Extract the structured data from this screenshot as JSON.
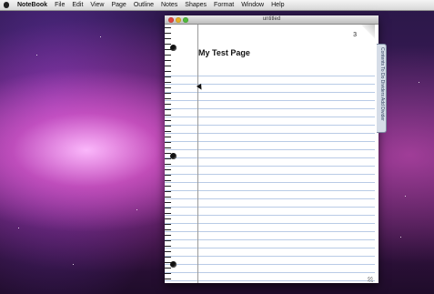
{
  "menubar": {
    "apple_icon": "apple-icon",
    "app_name": "NoteBook",
    "items": [
      "File",
      "Edit",
      "View",
      "Page",
      "Outline",
      "Notes",
      "Shapes",
      "Format",
      "Window",
      "Help"
    ]
  },
  "window": {
    "title": "untitled",
    "page_number": "3",
    "page_title": "My Test Page",
    "side_tabs": "Contents  To Do  Dividers  Add Divider"
  }
}
